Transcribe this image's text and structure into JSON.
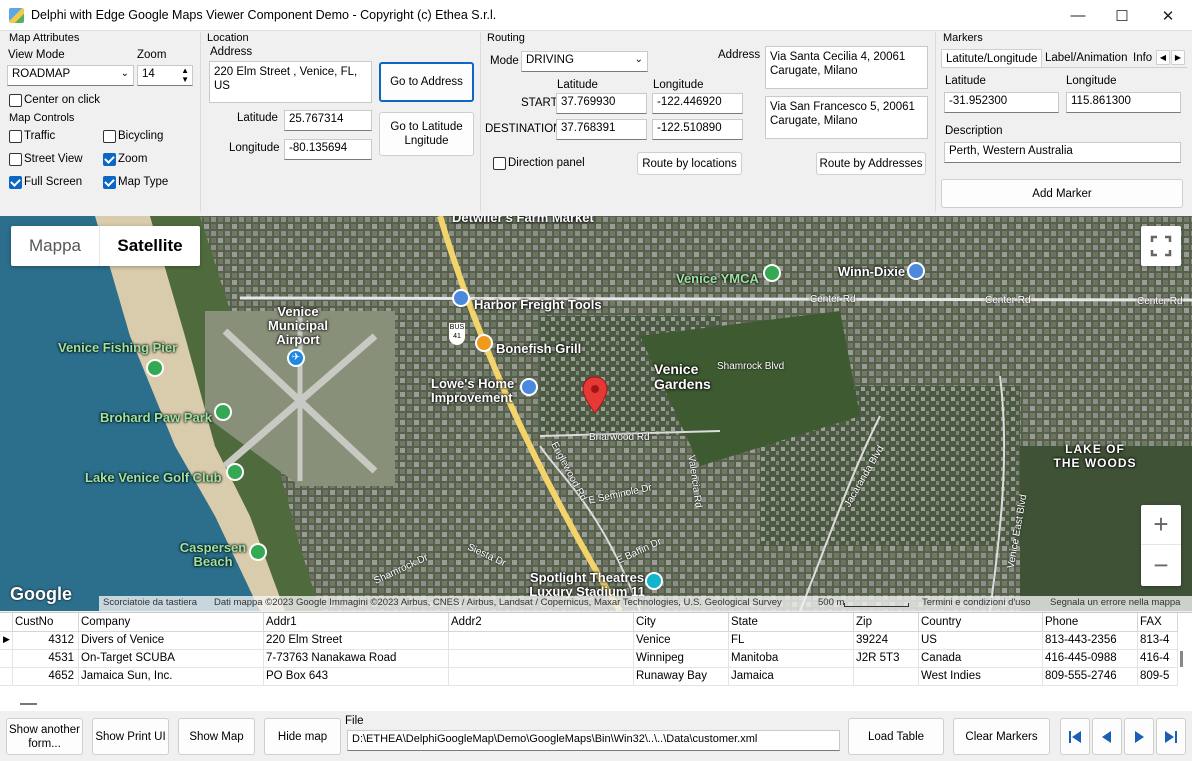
{
  "window": {
    "title": "Delphi with Edge Google Maps Viewer Component Demo - Copyright (c) Ethea S.r.l.",
    "minimize": "—",
    "maximize": "☐",
    "close": "✕"
  },
  "map_attributes": {
    "group": "Map Attributes",
    "view_mode_label": "View Mode",
    "view_mode": "ROADMAP",
    "zoom_label": "Zoom",
    "zoom": "14",
    "center_on_click": "Center on click",
    "controls_group": "Map Controls",
    "traffic": "Traffic",
    "bicycling": "Bicycling",
    "street_view": "Street View",
    "zoom_ctrl": "Zoom",
    "full_screen": "Full Screen",
    "map_type": "Map Type",
    "checked": {
      "center_on_click": false,
      "traffic": false,
      "bicycling": false,
      "street_view": false,
      "zoom": true,
      "full_screen": true,
      "map_type": true
    }
  },
  "location": {
    "group": "Location",
    "address_label": "Address",
    "address": "220 Elm Street , Venice, FL, US",
    "go_address": "Go to Address",
    "latitude_label": "Latitude",
    "latitude": "25.767314",
    "longitude_label": "Longitude",
    "longitude": "-80.135694",
    "go_latlng": "Go to Latitude Lngitude"
  },
  "routing": {
    "group": "Routing",
    "mode_label": "Mode",
    "mode": "DRIVING",
    "latitude_label": "Latitude",
    "longitude_label": "Longitude",
    "address_label": "Address",
    "start_label": "START",
    "start_lat": "37.769930",
    "start_lng": "-122.446920",
    "start_address": "Via Santa Cecilia 4, 20061 Carugate, Milano",
    "dest_label": "DESTINATION",
    "dest_lat": "37.768391",
    "dest_lng": "-122.510890",
    "dest_address": "Via San Francesco 5, 20061 Carugate, Milano",
    "direction_panel": "Direction panel",
    "route_locations": "Route by locations",
    "route_addresses": "Route by Addresses"
  },
  "markers": {
    "group": "Markers",
    "tabs": [
      "Latitute/Longitude",
      "Label/Animation",
      "Info"
    ],
    "latitude_label": "Latitude",
    "latitude": "-31.952300",
    "longitude_label": "Longitude",
    "longitude": "115.861300",
    "description_label": "Description",
    "description": "Perth, Western Australia",
    "add_marker": "Add Marker"
  },
  "map": {
    "type_map": "Mappa",
    "type_satellite": "Satellite",
    "labels": {
      "detwilers": "Detwiler's Farm Market",
      "harbor": "Harbor Freight Tools",
      "airport": "Venice Municipal Airport",
      "ymca": "Venice YMCA",
      "winn": "Winn-Dixie",
      "pier": "Venice Fishing Pier",
      "bonefish": "Bonefish Grill",
      "lowes": "Lowe's Home Improvement",
      "gardens": "Venice Gardens",
      "brohard": "Brohard Paw Park",
      "lake_woods": "LAKE OF THE WOODS",
      "golf": "Lake Venice Golf Club",
      "caspersen": "Caspersen Beach",
      "spotlight": "Spotlight Theatres Luxury Stadium 11"
    },
    "roads": {
      "center1": "Center Rd",
      "center2": "Center Rd",
      "center3": "Center Rd",
      "shamrock1": "Shamrock Blvd",
      "briarwood": "Briarwood Rd",
      "englewood": "Englewood Rd",
      "seminole": "E Seminole Dr",
      "valencia": "Valencia Rd",
      "jacaranda": "Jacaranda Blvd",
      "venice_east": "Venice East Blvd",
      "baffin": "E Baffin Dr",
      "shamrock2": "Shamrock Dr",
      "siesta": "Siesta Dr",
      "us41": "41",
      "bus": "BUS"
    },
    "google": "Google",
    "shortcuts": "Scorciatoie da tastiera",
    "attribution": "Dati mappa ©2023 Google Immagini ©2023 Airbus, CNES / Airbus, Landsat / Copernicus, Maxar Technologies, U.S. Geological Survey",
    "scale": "500 m",
    "terms": "Termini e condizioni d'uso",
    "report": "Segnala un errore nella mappa",
    "zoom_in": "+",
    "zoom_out": "−"
  },
  "table": {
    "columns": [
      "CustNo",
      "Company",
      "Addr1",
      "Addr2",
      "City",
      "State",
      "Zip",
      "Country",
      "Phone",
      "FAX"
    ],
    "rows": [
      [
        "4312",
        "Divers of Venice",
        "220 Elm Street",
        "",
        "Venice",
        "FL",
        "39224",
        "US",
        "813-443-2356",
        "813-4"
      ],
      [
        "4531",
        "On-Target SCUBA",
        "7-73763 Nanakawa Road",
        "",
        "Winnipeg",
        "Manitoba",
        "J2R 5T3",
        "Canada",
        "416-445-0988",
        "416-4"
      ],
      [
        "4652",
        "Jamaica Sun, Inc.",
        "PO Box 643",
        "",
        "Runaway Bay",
        "Jamaica",
        "",
        "West Indies",
        "809-555-2746",
        "809-5"
      ]
    ]
  },
  "bottom": {
    "show_form": "Show another form...",
    "show_print": "Show Print UI",
    "show_map": "Show Map",
    "hide_map": "Hide map",
    "file_label": "File",
    "file": "D:\\ETHEA\\DelphiGoogleMap\\Demo\\GoogleMaps\\Bin\\Win32\\..\\..\\Data\\customer.xml",
    "load_table": "Load Table",
    "clear_markers": "Clear Markers"
  },
  "colors": {
    "accent": "#0a67c3",
    "marker": "#e53935"
  }
}
